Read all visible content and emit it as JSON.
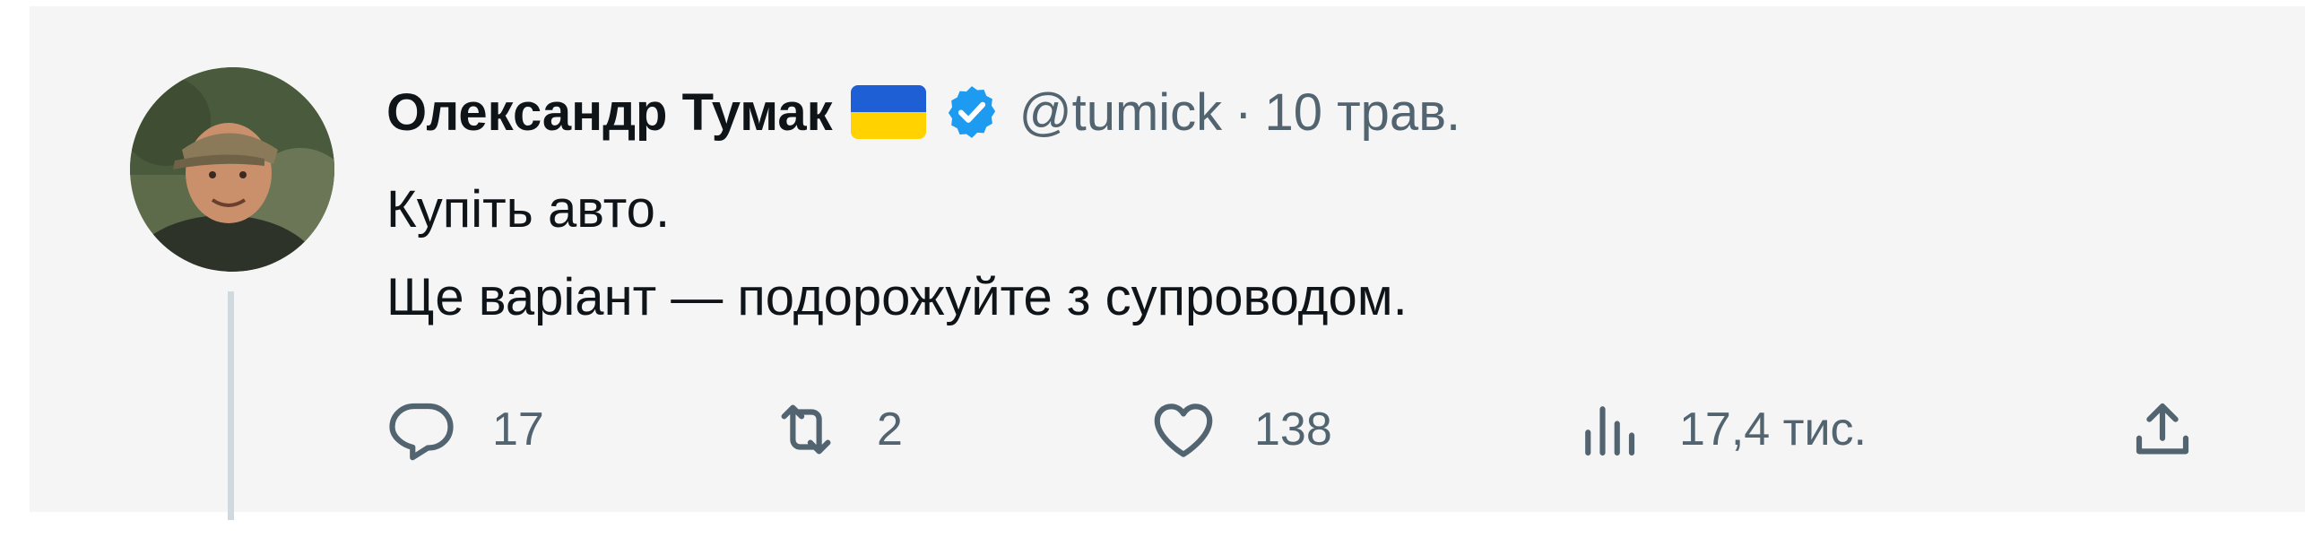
{
  "tweet": {
    "author": {
      "display_name": "Олександр Тумак",
      "flag_icon": "ukraine-flag-icon",
      "verified_icon": "verified-badge-icon",
      "handle": "@tumick"
    },
    "separator": "·",
    "date": "10 трав.",
    "body": {
      "line1": "Купіть авто.",
      "line2": "Ще варіант — подорожуйте з супроводом."
    },
    "actions": {
      "reply": {
        "icon": "reply-icon",
        "count": "17"
      },
      "retweet": {
        "icon": "retweet-icon",
        "count": "2"
      },
      "like": {
        "icon": "heart-icon",
        "count": "138"
      },
      "views": {
        "icon": "views-chart-icon",
        "count": "17,4 тис."
      },
      "share": {
        "icon": "share-icon"
      }
    }
  },
  "colors": {
    "background": "#f5f5f5",
    "text_primary": "#0f1419",
    "text_secondary": "#536471",
    "verified_blue": "#1d9bf0",
    "flag_blue": "#1f5fd6",
    "flag_yellow": "#ffd200",
    "thread_line": "#cfd9de"
  }
}
